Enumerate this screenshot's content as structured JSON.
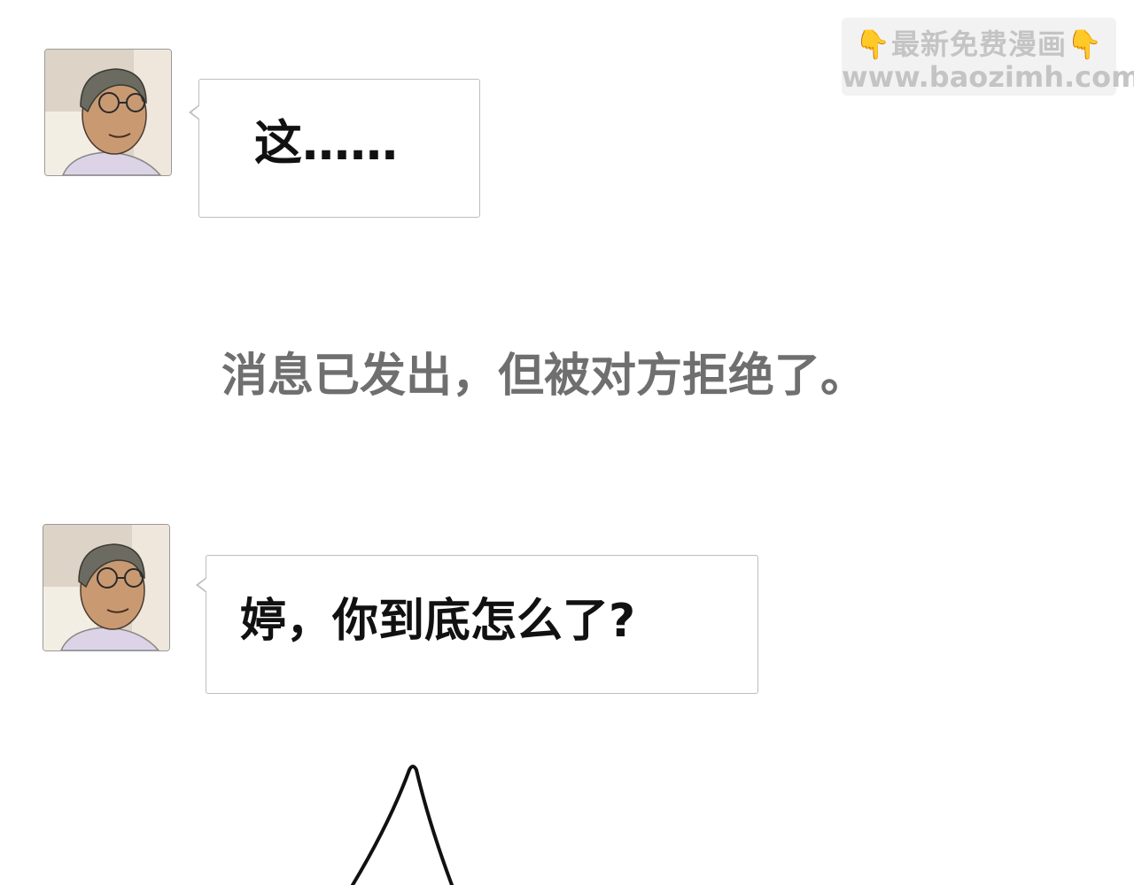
{
  "watermark": {
    "line1": "最新免费漫画",
    "line2": "www.baozimh.com",
    "hand_icon": "pointing-down-hand-icon"
  },
  "messages": [
    {
      "avatar": "man-with-glasses-avatar",
      "text": "这……"
    },
    {
      "avatar": "man-with-glasses-avatar",
      "text": "婷，你到底怎么了?"
    }
  ],
  "system_message": "消息已发出，但被对方拒绝了。",
  "colors": {
    "background": "#ffffff",
    "bubble_border": "#bdbdbd",
    "system_text": "#6f6f6f",
    "watermark_text": "#c4c4c4"
  }
}
